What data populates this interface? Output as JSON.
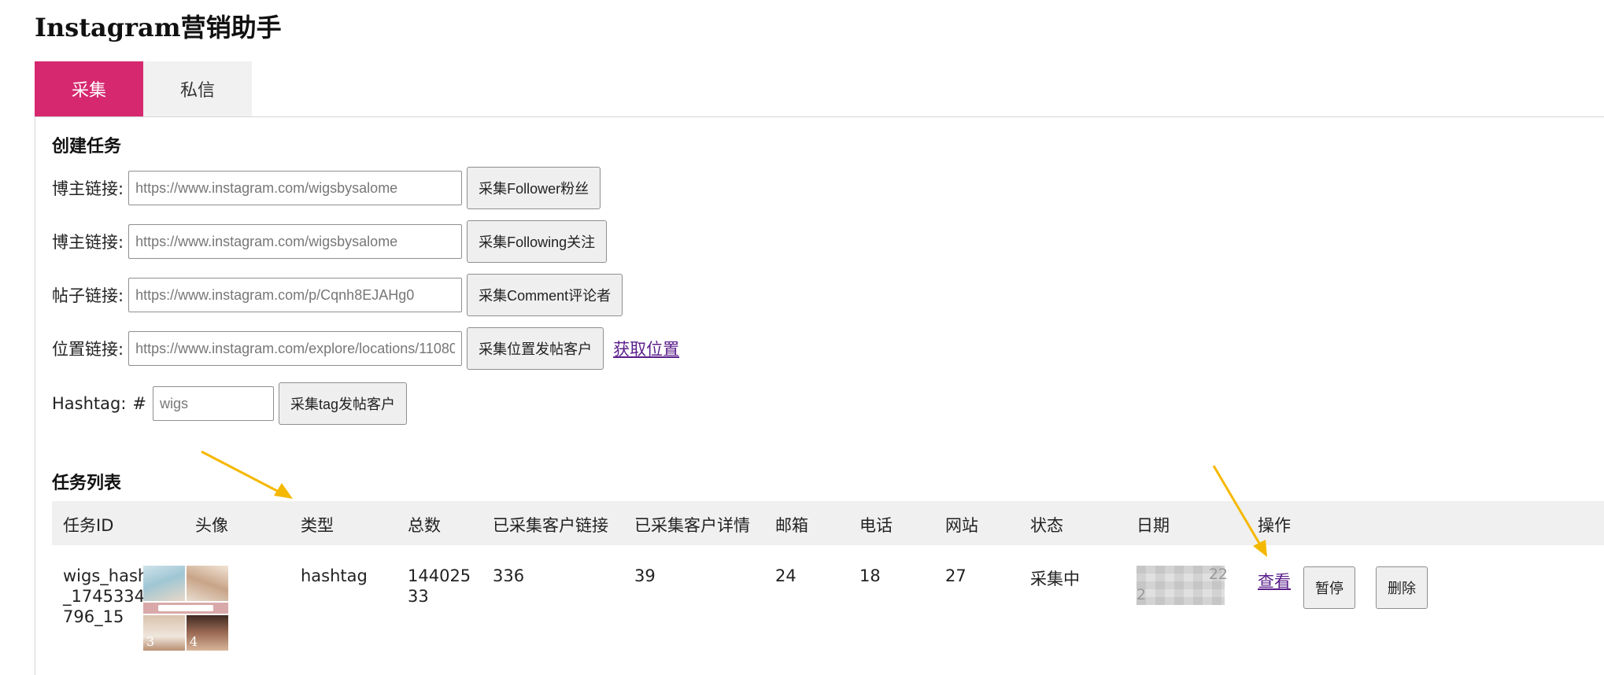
{
  "app": {
    "title": "Instagram营销助手"
  },
  "tabs": [
    {
      "label": "采集",
      "active": true
    },
    {
      "label": "私信",
      "active": false
    }
  ],
  "create_task": {
    "title": "创建任务",
    "rows": [
      {
        "label": "博主链接:",
        "placeholder": "https://www.instagram.com/wigsbysalome",
        "button": "采集Follower粉丝"
      },
      {
        "label": "博主链接:",
        "placeholder": "https://www.instagram.com/wigsbysalome",
        "button": "采集Following关注"
      },
      {
        "label": "帖子链接:",
        "placeholder": "https://www.instagram.com/p/Cqnh8EJAHg0",
        "button": "采集Comment评论者"
      },
      {
        "label": "位置链接:",
        "placeholder": "https://www.instagram.com/explore/locations/110808",
        "button": "采集位置发帖客户",
        "link": "获取位置"
      }
    ],
    "hashtag": {
      "label": "Hashtag:",
      "prefix": "#",
      "placeholder": "wigs",
      "button": "采集tag发帖客户"
    }
  },
  "task_list": {
    "title": "任务列表",
    "columns": [
      "任务ID",
      "头像",
      "类型",
      "总数",
      "已采集客户链接",
      "已采集客户详情",
      "邮箱",
      "电话",
      "网站",
      "状态",
      "日期",
      "操作"
    ],
    "rows": [
      {
        "id_lines": [
          "wigs_hashtag",
          "_1745334672",
          "796_15"
        ],
        "avatar_numbers": [
          "3",
          "4"
        ],
        "type": "hashtag",
        "total_lines": [
          "144025",
          "33"
        ],
        "links": "336",
        "details": "39",
        "email": "24",
        "phone": "18",
        "website": "27",
        "status": "采集中",
        "date_fragments": [
          "22",
          "2"
        ],
        "view_label": "查看",
        "pause_label": "暂停",
        "delete_label": "删除"
      }
    ]
  },
  "colors": {
    "accent": "#d6286f",
    "link": "#5a1e8a",
    "arrow": "#f5b800"
  }
}
